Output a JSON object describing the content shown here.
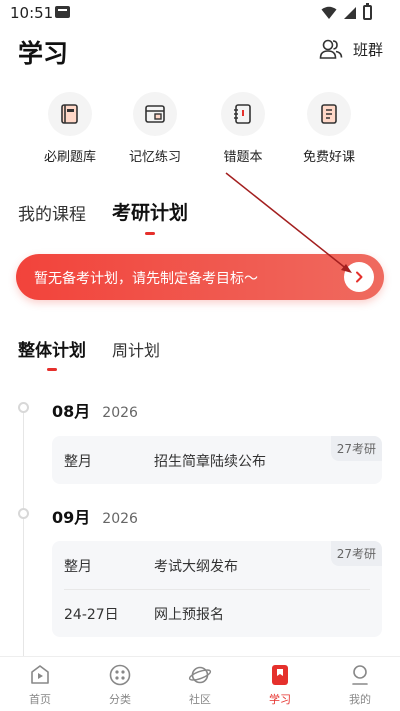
{
  "status": {
    "time": "10:51"
  },
  "header": {
    "title": "学习",
    "class_group_label": "班群"
  },
  "quick_entries": [
    {
      "label": "必刷题库",
      "icon": "question-bank-icon"
    },
    {
      "label": "记忆练习",
      "icon": "memory-practice-icon"
    },
    {
      "label": "错题本",
      "icon": "mistake-book-icon"
    },
    {
      "label": "免费好课",
      "icon": "free-course-icon"
    }
  ],
  "main_tabs": [
    {
      "label": "我的课程",
      "active": false
    },
    {
      "label": "考研计划",
      "active": true
    }
  ],
  "banner": {
    "text": "暂无备考计划，请先制定备考目标～"
  },
  "sub_tabs": [
    {
      "label": "整体计划",
      "active": true
    },
    {
      "label": "周计划",
      "active": false
    }
  ],
  "timeline": [
    {
      "month": "08月",
      "year": "2026",
      "tag": "27考研",
      "events": [
        {
          "when": "整月",
          "what": "招生简章陆续公布"
        }
      ]
    },
    {
      "month": "09月",
      "year": "2026",
      "tag": "27考研",
      "events": [
        {
          "when": "整月",
          "what": "考试大纲发布"
        },
        {
          "when": "24-27日",
          "what": "网上预报名"
        }
      ]
    }
  ],
  "bottom_nav": [
    {
      "label": "首页",
      "icon": "home-play-icon",
      "active": false
    },
    {
      "label": "分类",
      "icon": "category-icon",
      "active": false
    },
    {
      "label": "社区",
      "icon": "community-planet-icon",
      "active": false
    },
    {
      "label": "学习",
      "icon": "study-bookmark-icon",
      "active": true
    },
    {
      "label": "我的",
      "icon": "profile-icon",
      "active": false
    }
  ],
  "colors": {
    "accent": "#e5302c",
    "banner_start": "#f2433b",
    "banner_end": "#ef6a5f",
    "annotation_arrow": "#a31f1f"
  }
}
